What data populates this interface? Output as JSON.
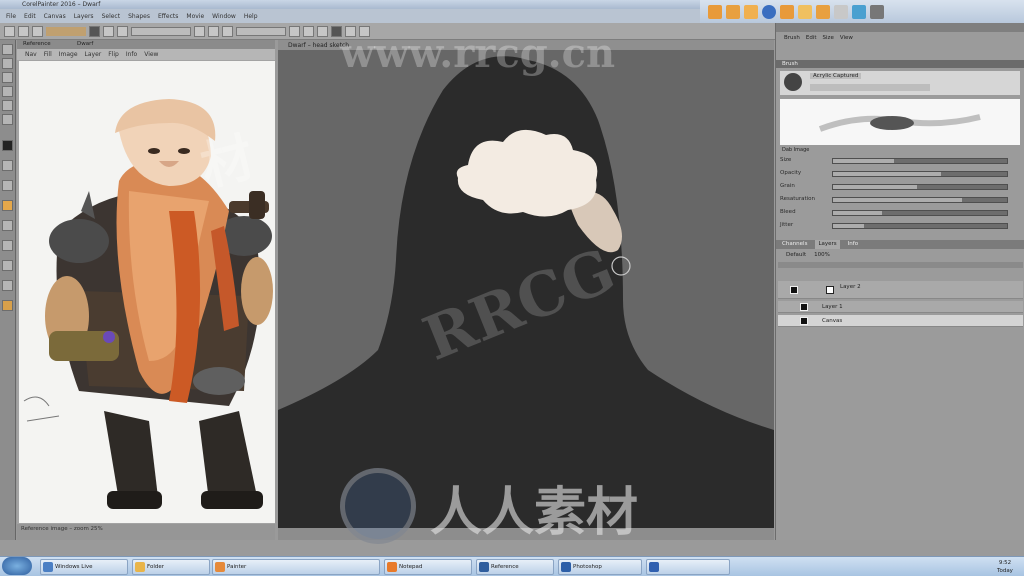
{
  "titlebar": {
    "title": "CorelPainter 2016 – Dwarf"
  },
  "menubar": {
    "items": [
      "File",
      "Edit",
      "Canvas",
      "Layers",
      "Select",
      "Shapes",
      "Effects",
      "Movie",
      "Window",
      "Help"
    ]
  },
  "ref_panel": {
    "tabs": [
      "Reference",
      "Dwarf"
    ],
    "menu": [
      "Nav",
      "Fill",
      "Image",
      "Layer",
      "Flip",
      "Info",
      "View"
    ],
    "status": "Reference image – zoom 25%"
  },
  "canvas": {
    "tab_label": "Dwarf – head sketch",
    "bg_color": "#676767",
    "hood_color": "#2b2b2b",
    "cloud_color": "#f3ebe2",
    "smoke_color": "#d8c8b8"
  },
  "right_panel": {
    "header": [
      "Brush",
      "Edit",
      "Size",
      "View"
    ],
    "brush_section": "Brush",
    "brush_variant": "Acrylic Captured",
    "dab_section": "Dab Image",
    "sliders": [
      {
        "label": "Size",
        "value": 0.35
      },
      {
        "label": "Opacity",
        "value": 0.62
      },
      {
        "label": "Grain",
        "value": 0.48
      },
      {
        "label": "Resaturation",
        "value": 0.74
      },
      {
        "label": "Bleed",
        "value": 0.28
      },
      {
        "label": "Jitter",
        "value": 0.18
      }
    ],
    "layers_tabs": [
      "Channels",
      "Layers",
      "Info"
    ],
    "layers_toolbar": [
      "Default",
      "100%"
    ],
    "layers": [
      {
        "name": "Layer 2",
        "selected": false
      },
      {
        "name": "Layer 1",
        "selected": false
      },
      {
        "name": "Canvas",
        "selected": true
      }
    ]
  },
  "taskbar": {
    "buttons": [
      "Windows Live",
      "Folder",
      "Painter",
      "Notepad",
      "Reference",
      "Photoshop"
    ],
    "clock_time": "9:52",
    "clock_date": "Today"
  },
  "watermarks": {
    "url": "www.rrcg.cn",
    "rrcg": "RRCG",
    "cn_brand": "人人素材",
    "side_cn": "材"
  }
}
